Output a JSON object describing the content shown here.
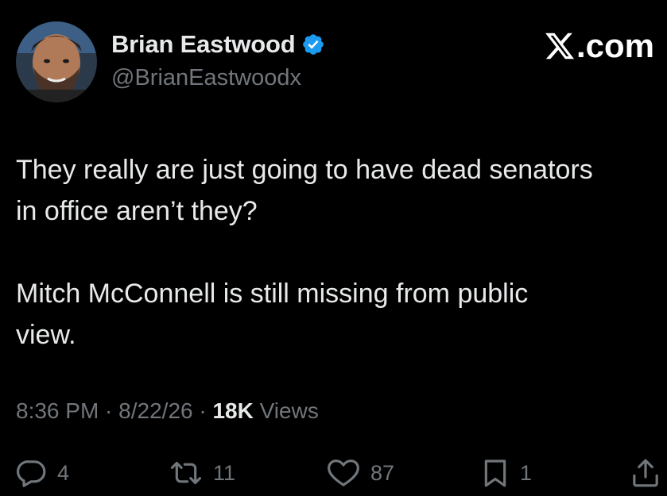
{
  "author": {
    "display_name": "Brian Eastwood",
    "handle": "@BrianEastwoodx",
    "verified": true,
    "avatar_icon": "avatar-photo"
  },
  "brand": {
    "suffix": ".com",
    "logo_icon": "x-logo-icon"
  },
  "tweet": {
    "paragraphs": [
      "They really are just going to have dead senators\nin office aren’t they?",
      "Mitch McConnell is still missing from public\nview."
    ]
  },
  "meta": {
    "time": "8:36 PM",
    "sep1": " · ",
    "date": "8/22/26",
    "sep2": " · ",
    "views_count": "18K",
    "views_label": " Views"
  },
  "actions": {
    "replies": "4",
    "reposts": "11",
    "likes": "87",
    "bookmarks": "1"
  },
  "colors": {
    "background": "#000000",
    "text": "#e7e9ea",
    "secondary": "#71767b",
    "verified": "#1d9bf0"
  }
}
